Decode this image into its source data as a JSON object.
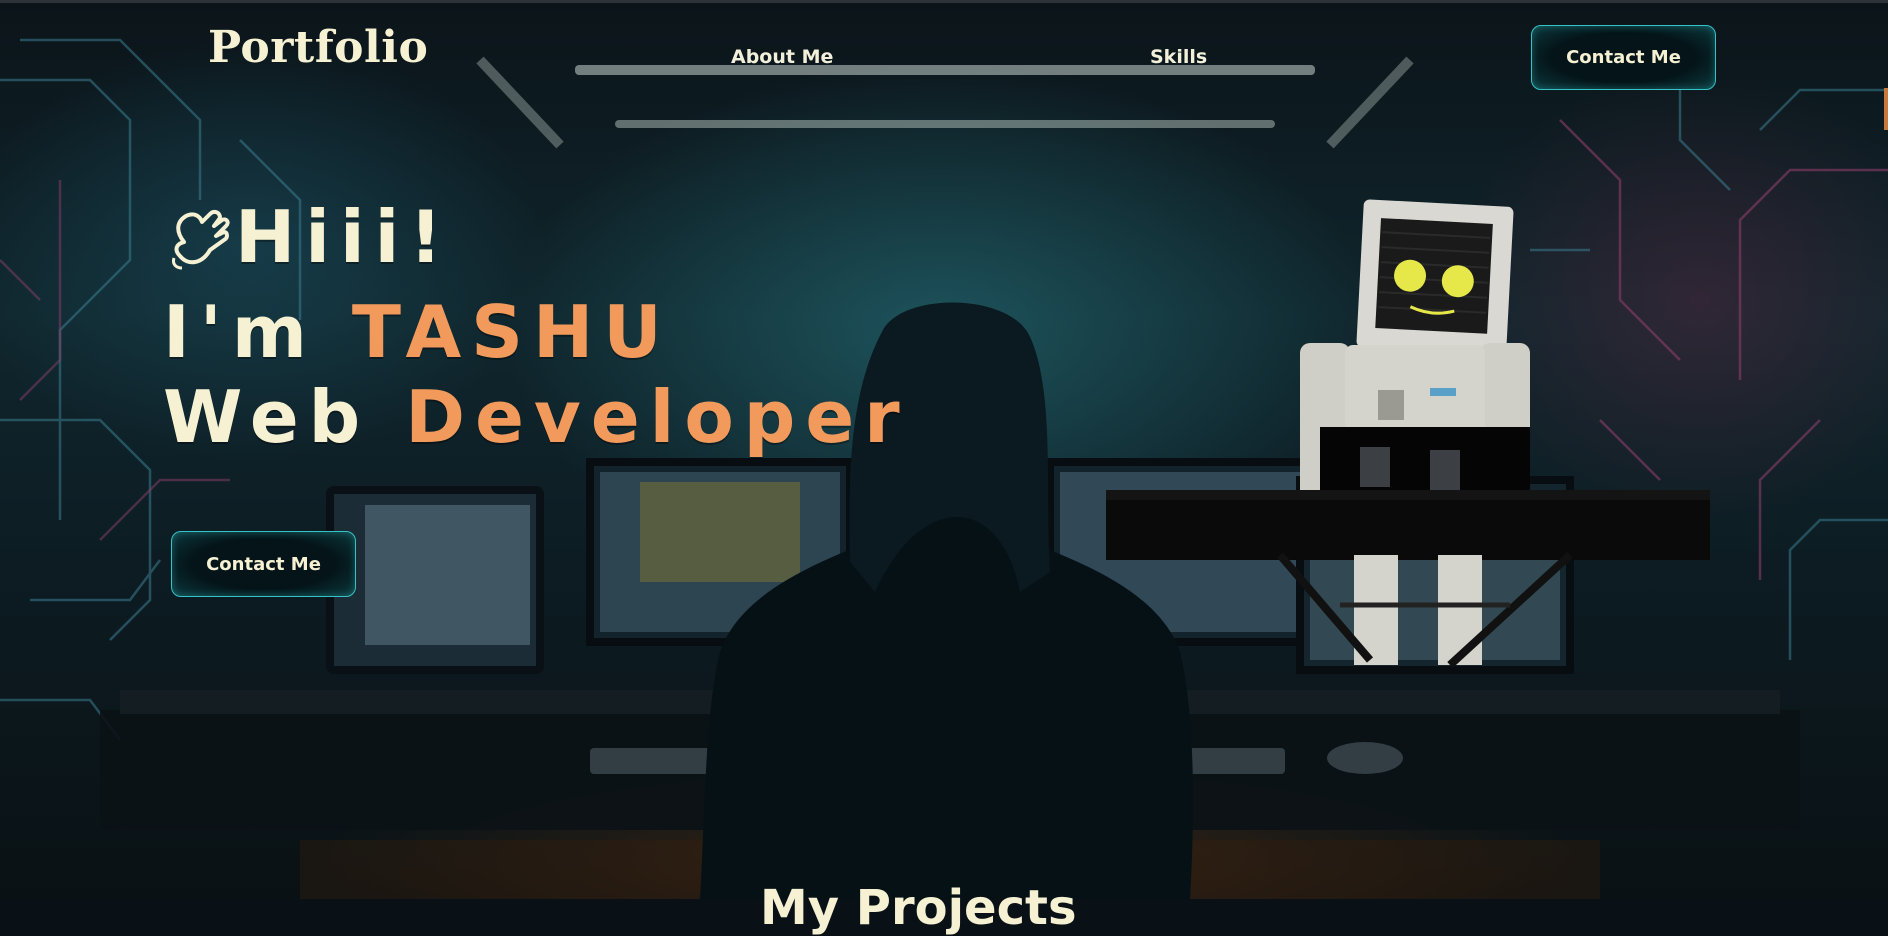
{
  "nav": {
    "logo": "Portfolio",
    "links": [
      {
        "label": "About Me"
      },
      {
        "label": "Skills"
      }
    ],
    "contact_button": "Contact Me"
  },
  "hero": {
    "greeting": "Hiii!",
    "intro_prefix": "I'm ",
    "name": "TASHU",
    "role_prefix": "Web ",
    "role": "Developer",
    "contact_button": "Contact Me",
    "wave_icon": "waving-hand-icon"
  },
  "section": {
    "title": "My Projects"
  },
  "colors": {
    "accent": "#f29a5c",
    "text": "#f5f1d2",
    "button_border": "#35c3c7"
  }
}
